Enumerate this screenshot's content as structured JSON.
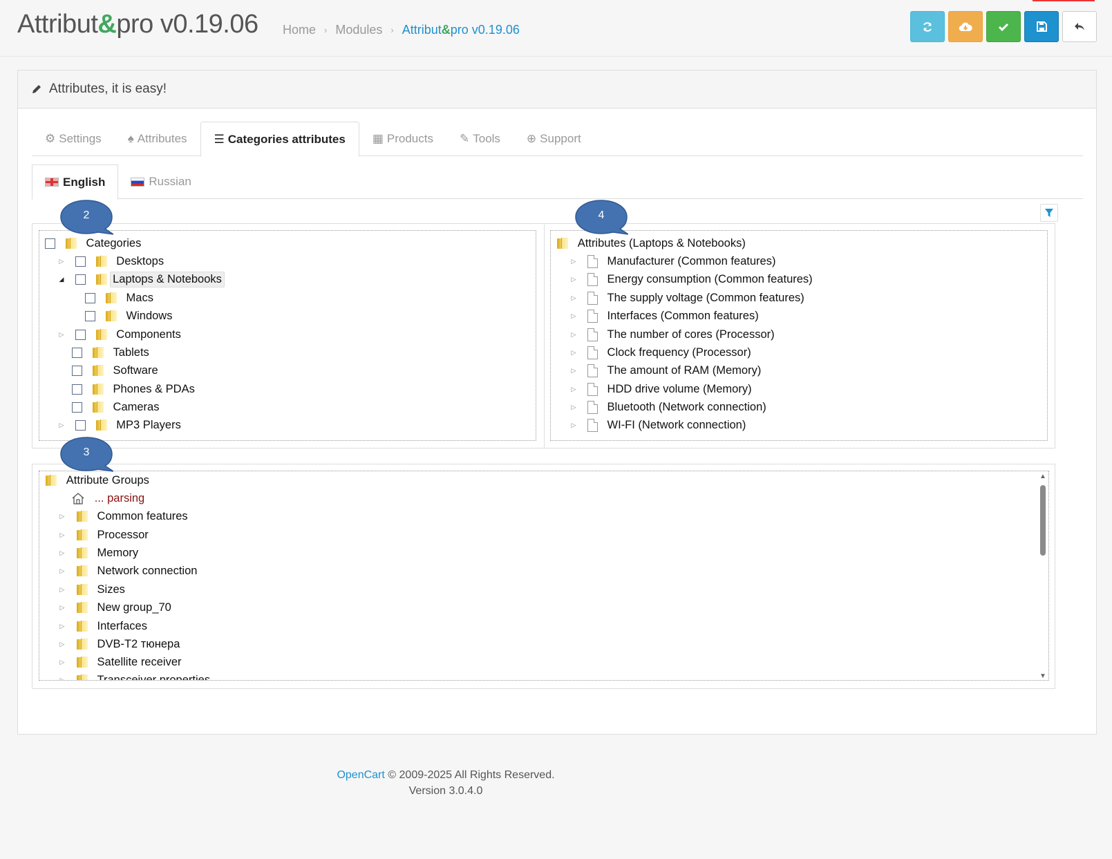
{
  "header": {
    "title_pre": "Attribut",
    "title_amp": "&",
    "title_post": "pro v0.19.06",
    "breadcrumbs": [
      "Home",
      "Modules"
    ],
    "breadcrumb_active_pre": "Attribut",
    "breadcrumb_active_amp": "&",
    "breadcrumb_active_post": "pro v0.19.06",
    "breadcrumb_separator": "›"
  },
  "toolbar": {
    "buttons": [
      {
        "icon": "refresh-icon",
        "color": "#5bc0de"
      },
      {
        "icon": "cloud-download-icon",
        "color": "#f0ad4e"
      },
      {
        "icon": "check-icon",
        "color": "#4cb64c"
      },
      {
        "icon": "save-icon",
        "color": "#1e91cf"
      },
      {
        "icon": "reply-icon",
        "color": "#ffffff"
      }
    ]
  },
  "panel": {
    "heading": "Attributes, it is easy!"
  },
  "tabs": [
    {
      "label": "Settings",
      "icon": "gear-icon"
    },
    {
      "label": "Attributes",
      "icon": "tree-icon"
    },
    {
      "label": "Categories attributes",
      "icon": "list-icon",
      "active": true
    },
    {
      "label": "Products",
      "icon": "grid-icon"
    },
    {
      "label": "Tools",
      "icon": "wrench-icon"
    },
    {
      "label": "Support",
      "icon": "lifebuoy-icon"
    }
  ],
  "languages": [
    {
      "label": "English",
      "active": true
    },
    {
      "label": "Russian"
    }
  ],
  "bubbles": [
    "2",
    "4",
    "3"
  ],
  "categories_tree": {
    "root": "Categories",
    "items": [
      "Desktops",
      "Laptops & Notebooks",
      "Macs",
      "Windows",
      "Components",
      "Tablets",
      "Software",
      "Phones & PDAs",
      "Cameras",
      "MP3 Players"
    ]
  },
  "attributes_tree": {
    "root": "Attributes (Laptops & Notebooks)",
    "items": [
      "Manufacturer (Common features)",
      "Energy consumption (Common features)",
      "The supply voltage (Common features)",
      "Interfaces (Common features)",
      "The number of cores (Processor)",
      "Clock frequency (Processor)",
      "The amount of RAM (Memory)",
      "HDD drive volume (Memory)",
      "Bluetooth (Network connection)",
      "WI-FI (Network connection)"
    ]
  },
  "groups_tree": {
    "root": "Attribute Groups",
    "parsing": "... parsing",
    "items": [
      "Common features",
      "Processor",
      "Memory",
      "Network connection",
      "Sizes",
      "New group_70",
      "Interfaces",
      "DVB-T2 тюнера",
      "Satellite receiver",
      "Transceiver properties"
    ]
  },
  "footer": {
    "link": "OpenCart",
    "copyright": "© 2009-2025 All Rights Reserved.",
    "version": "Version 3.0.4.0"
  }
}
